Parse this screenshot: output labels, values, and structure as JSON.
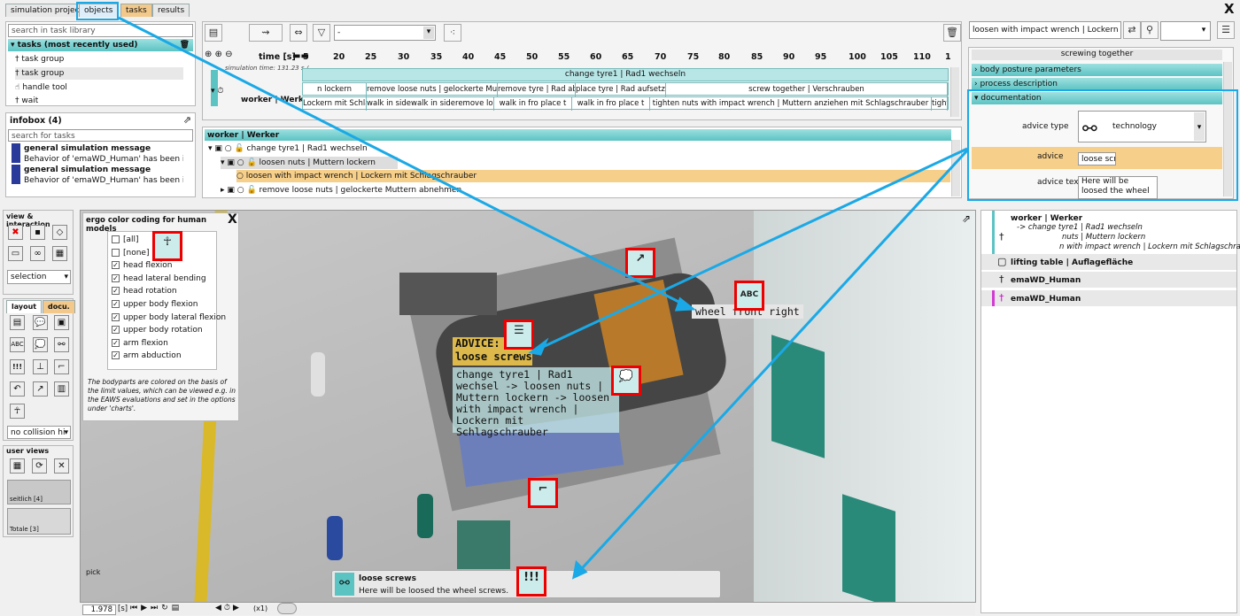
{
  "tabs": [
    "simulation project",
    "objects",
    "tasks",
    "results"
  ],
  "close_glyph": "X",
  "library": {
    "search_placeholder": "search in task library",
    "header": "tasks (most recently used)",
    "items": [
      "task group",
      "task group",
      "handle tool",
      "wait"
    ]
  },
  "infobox": {
    "title": "infobox (4)",
    "search_placeholder": "search for tasks",
    "messages": [
      {
        "title": "general simulation message",
        "text": "Behavior of 'emaWD_Human' has been ignore"
      },
      {
        "title": "general simulation message",
        "text": "Behavior of 'emaWD_Human' has been ignore"
      }
    ]
  },
  "timeline": {
    "dropdown_value": "-",
    "time_label": "time [s]",
    "ticks": [
      "5",
      "20",
      "25",
      "30",
      "35",
      "40",
      "45",
      "50",
      "55",
      "60",
      "65",
      "70",
      "75",
      "80",
      "85",
      "90",
      "95",
      "100",
      "105",
      "110",
      "1"
    ],
    "sim_time": "simulation time: 131.23 s /...",
    "lane1": "change tyre1 | Rad1 wechseln",
    "lane2": [
      "n lockern",
      "remove loose nuts | gelockerte Mutte",
      "remove tyre | Rad abne",
      "place tyre | Rad aufsetzen",
      "screw together | Verschrauben"
    ],
    "lane3": [
      "Lockern mit Schla",
      "walk in sidewalk in sideremove loo",
      "walk in fro place t",
      "walk in fro place t",
      "tighten nuts with impact wrench | Muttern anziehen mit Schlagschrauber",
      "tight"
    ],
    "worker_label": "worker | Werker"
  },
  "tree": {
    "header": "worker | Werker",
    "rows": [
      "change tyre1 | Rad1 wechseln",
      "loosen nuts | Muttern lockern",
      "loosen with impact wrench | Lockern mit Schlagschrauber",
      "remove loose nuts | gelockerte Muttern abnehmen"
    ]
  },
  "props": {
    "selected": "loosen with impact wrench | Lockern mit Schla",
    "title": "screwing together",
    "sections": [
      "body posture parameters",
      "process description",
      "documentation"
    ],
    "advice_type_label": "advice type",
    "advice_type_value": "technology",
    "advice_label": "advice",
    "advice_value": "loose screws",
    "advice_text_label": "advice text",
    "advice_text_value": "Here will be loosed the wheel screws."
  },
  "left": {
    "view_title": "view & interaction",
    "selection": "selection",
    "layout_tab": "layout",
    "docu_tab": "docu.",
    "collision": "no collision hi",
    "user_views_title": "user views",
    "views": [
      "seitlich [4]",
      "Totale [3]"
    ]
  },
  "ergo": {
    "title": "ergo color coding for human models",
    "items": [
      {
        "label": "[all]",
        "checked": false
      },
      {
        "label": "[none]",
        "checked": false
      },
      {
        "label": "head flexion",
        "checked": true
      },
      {
        "label": "head lateral bending",
        "checked": true
      },
      {
        "label": "head rotation",
        "checked": true
      },
      {
        "label": "upper body flexion",
        "checked": true
      },
      {
        "label": "upper body lateral flexion",
        "checked": true
      },
      {
        "label": "upper body rotation",
        "checked": true
      },
      {
        "label": "arm flexion",
        "checked": true
      },
      {
        "label": "arm abduction",
        "checked": true
      }
    ],
    "note": "The bodyparts are colored on the basis of the limit values, which can be viewed e.g. in the EAWS evaluations and set in the options under 'charts'."
  },
  "scene": {
    "wheel_label": "wheel front right",
    "advice_title": "ADVICE:",
    "advice_sub": "loose screws",
    "task_text": "change tyre1 | Rad1 wechsel -> loosen nuts | Muttern lockern -> loosen with impact wrench | Lockern mit Schlagschrauber",
    "pick": "pick",
    "toast_title": "loose screws",
    "toast_text": "Here will be loosed the wheel screws.",
    "exclaim": "!!!"
  },
  "playback": {
    "time": "1.978",
    "unit": "[s]",
    "speed": "(x1)"
  },
  "outline": {
    "rows": [
      "worker | Werker",
      "-> change tyre1 | Rad1 wechseln",
      "nuts | Muttern lockern",
      "n with impact wrench | Lockern mit Schlagschrauber",
      "lifting table | Auflagefläche",
      "emaWD_Human",
      "emaWD_Human"
    ]
  },
  "colors": {
    "accent": "#1aa9e6",
    "teal": "#5cc3c3",
    "marker": "#e00000"
  }
}
